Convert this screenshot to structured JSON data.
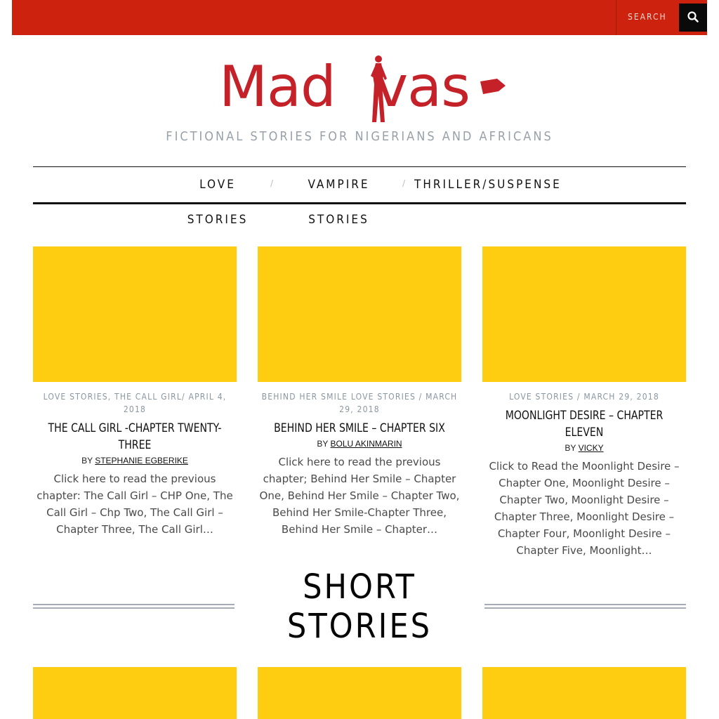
{
  "topbar": {
    "search_label": "SEARCH",
    "accent_color": "#cd220d",
    "search_icon": "search-icon"
  },
  "header": {
    "logo_text_left": "Mad",
    "logo_text_right": "vas",
    "tagline": "FICTIONAL STORIES FOR NIGERIANS AND AFRICANS"
  },
  "nav": {
    "items": [
      {
        "line1": "LOVE",
        "line2": "STORIES"
      },
      {
        "line1": "VAMPIRE",
        "line2": "STORIES"
      },
      {
        "line1": "THRILLER/SUSPENSE",
        "line2": ""
      }
    ],
    "separator": "/"
  },
  "posts": [
    {
      "meta": "LOVE STORIES, THE CALL GIRL/ APRIL 4, 2018",
      "title": "THE CALL GIRL -CHAPTER TWENTY-THREE",
      "by": "BY",
      "author": "STEPHANIE EGBERIKE",
      "excerpt": "Click here to read the previous chapter: The Call Girl – CHP One, The Call Girl – Chp Two, The Call Girl – Chapter Three, The Call Girl…"
    },
    {
      "meta": "BEHIND HER SMILE LOVE STORIES / MARCH 29, 2018",
      "title": "BEHIND HER SMILE – CHAPTER SIX",
      "by": "BY",
      "author": "BOLU AKINMARIN",
      "excerpt": "Click here to read the previous chapter; Behind Her Smile – Chapter One, Behind Her Smile – Chapter Two, Behind Her Smile-Chapter Three, Behind Her Smile – Chapter…"
    },
    {
      "meta": "LOVE STORIES / MARCH 29, 2018",
      "title": "MOONLIGHT DESIRE – CHAPTER ELEVEN",
      "by": "BY",
      "author": "VICKY",
      "excerpt": "Click to Read the Moonlight Desire – Chapter One, Moonlight Desire – Chapter Two, Moonlight Desire – Chapter Three, Moonlight Desire – Chapter Four, Moonlight Desire – Chapter Five, Moonlight…"
    }
  ],
  "section": {
    "line1": "SHORT",
    "line2": "STORIES"
  },
  "colors": {
    "thumbnail": "#fecc10",
    "logo": "#c42129"
  }
}
